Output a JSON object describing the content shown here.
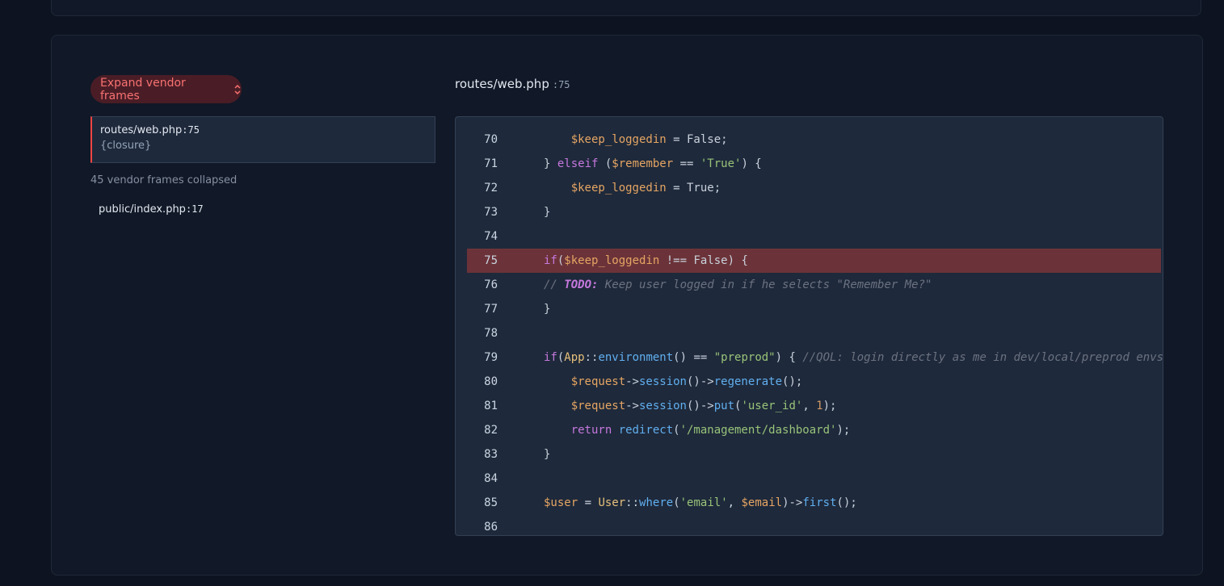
{
  "expand_button": {
    "label": "Expand vendor frames"
  },
  "frames": {
    "active": {
      "file": "routes/web.php",
      "line": ":75",
      "function": "{closure}"
    },
    "collapsed_note": "45 vendor frames collapsed",
    "plain": {
      "file": "public/index.php",
      "line": ":17"
    }
  },
  "code_view": {
    "file": "routes/web.php",
    "line": ":75",
    "highlight_line": 75,
    "lines": [
      {
        "n": "70",
        "indent": 2,
        "tokens": [
          [
            "var",
            "$keep_loggedin"
          ],
          [
            "op",
            " = False;"
          ]
        ]
      },
      {
        "n": "71",
        "indent": 1,
        "tokens": [
          [
            "op",
            "} "
          ],
          [
            "kw",
            "elseif"
          ],
          [
            "op",
            " ("
          ],
          [
            "var",
            "$remember"
          ],
          [
            "op",
            " == "
          ],
          [
            "str",
            "'True'"
          ],
          [
            "op",
            ") {"
          ]
        ]
      },
      {
        "n": "72",
        "indent": 2,
        "tokens": [
          [
            "var",
            "$keep_loggedin"
          ],
          [
            "op",
            " = True;"
          ]
        ]
      },
      {
        "n": "73",
        "indent": 1,
        "tokens": [
          [
            "op",
            "}"
          ]
        ]
      },
      {
        "n": "74",
        "indent": 0,
        "tokens": []
      },
      {
        "n": "75",
        "indent": 1,
        "tokens": [
          [
            "kw",
            "if"
          ],
          [
            "op",
            "("
          ],
          [
            "var",
            "$keep_loggedin"
          ],
          [
            "op",
            " !== False) {"
          ]
        ]
      },
      {
        "n": "76",
        "indent": 1,
        "tokens": [
          [
            "cm",
            "// "
          ],
          [
            "todo",
            "TODO:"
          ],
          [
            "cm",
            " Keep user logged in if he selects \"Remember Me?\""
          ]
        ]
      },
      {
        "n": "77",
        "indent": 1,
        "tokens": [
          [
            "op",
            "}"
          ]
        ]
      },
      {
        "n": "78",
        "indent": 0,
        "tokens": []
      },
      {
        "n": "79",
        "indent": 1,
        "tokens": [
          [
            "kw",
            "if"
          ],
          [
            "op",
            "("
          ],
          [
            "cls",
            "App"
          ],
          [
            "op",
            "::"
          ],
          [
            "fn",
            "environment"
          ],
          [
            "op",
            "() == "
          ],
          [
            "str",
            "\"preprod\""
          ],
          [
            "op",
            ") { "
          ],
          [
            "cm",
            "//QOL: login directly as me in dev/local/preprod envs"
          ]
        ]
      },
      {
        "n": "80",
        "indent": 2,
        "tokens": [
          [
            "var",
            "$request"
          ],
          [
            "op",
            "->"
          ],
          [
            "fn",
            "session"
          ],
          [
            "op",
            "()->"
          ],
          [
            "fn",
            "regenerate"
          ],
          [
            "op",
            "();"
          ]
        ]
      },
      {
        "n": "81",
        "indent": 2,
        "tokens": [
          [
            "var",
            "$request"
          ],
          [
            "op",
            "->"
          ],
          [
            "fn",
            "session"
          ],
          [
            "op",
            "()->"
          ],
          [
            "fn",
            "put"
          ],
          [
            "op",
            "("
          ],
          [
            "str",
            "'user_id'"
          ],
          [
            "op",
            ", "
          ],
          [
            "num",
            "1"
          ],
          [
            "op",
            ");"
          ]
        ]
      },
      {
        "n": "82",
        "indent": 2,
        "tokens": [
          [
            "kw",
            "return"
          ],
          [
            "op",
            " "
          ],
          [
            "fn",
            "redirect"
          ],
          [
            "op",
            "("
          ],
          [
            "str",
            "'/management/dashboard'"
          ],
          [
            "op",
            ");"
          ]
        ]
      },
      {
        "n": "83",
        "indent": 1,
        "tokens": [
          [
            "op",
            "}"
          ]
        ]
      },
      {
        "n": "84",
        "indent": 0,
        "tokens": []
      },
      {
        "n": "85",
        "indent": 1,
        "tokens": [
          [
            "var",
            "$user"
          ],
          [
            "op",
            " = "
          ],
          [
            "cls",
            "User"
          ],
          [
            "op",
            "::"
          ],
          [
            "fn",
            "where"
          ],
          [
            "op",
            "("
          ],
          [
            "str",
            "'email'"
          ],
          [
            "op",
            ", "
          ],
          [
            "var",
            "$email"
          ],
          [
            "op",
            ")->"
          ],
          [
            "fn",
            "first"
          ],
          [
            "op",
            "();"
          ]
        ]
      },
      {
        "n": "86",
        "indent": 0,
        "tokens": []
      }
    ]
  }
}
